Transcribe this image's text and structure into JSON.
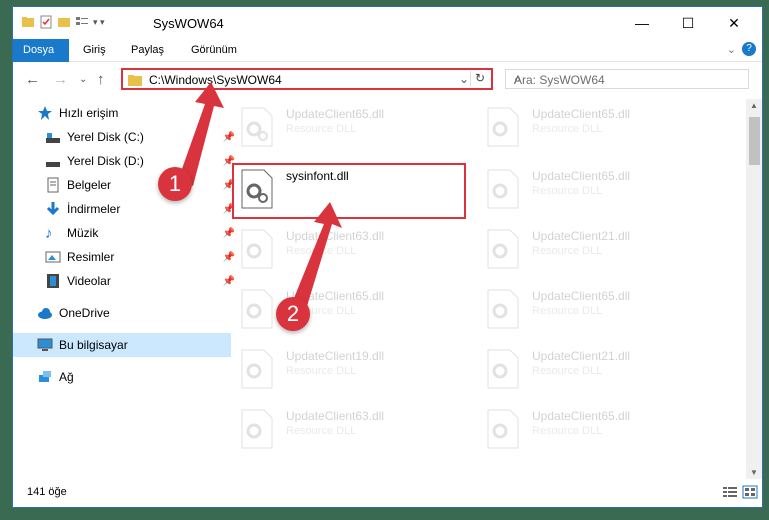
{
  "window": {
    "title": "SysWOW64",
    "controls": {
      "minimize": "—",
      "maximize": "☐",
      "close": "✕"
    }
  },
  "ribbon": {
    "tabs": [
      "Dosya",
      "Giriş",
      "Paylaş",
      "Görünüm"
    ]
  },
  "address": {
    "path": "C:\\Windows\\SysWOW64",
    "search_placeholder": "Ara: SysWOW64"
  },
  "sidebar": {
    "items": [
      {
        "label": "Hızlı erişim",
        "icon": "star-icon",
        "pinned": false
      },
      {
        "label": "Yerel Disk (C:)",
        "icon": "drive-icon",
        "pinned": true
      },
      {
        "label": "Yerel Disk (D:)",
        "icon": "drive-icon",
        "pinned": true
      },
      {
        "label": "Belgeler",
        "icon": "documents-icon",
        "pinned": true
      },
      {
        "label": "İndirmeler",
        "icon": "download-icon",
        "pinned": true
      },
      {
        "label": "Müzik",
        "icon": "music-icon",
        "pinned": true
      },
      {
        "label": "Resimler",
        "icon": "pictures-icon",
        "pinned": true
      },
      {
        "label": "Videolar",
        "icon": "videos-icon",
        "pinned": true
      },
      {
        "label": "OneDrive",
        "icon": "cloud-icon",
        "pinned": false
      },
      {
        "label": "Bu bilgisayar",
        "icon": "computer-icon",
        "pinned": false
      },
      {
        "label": "Ağ",
        "icon": "network-icon",
        "pinned": false
      }
    ]
  },
  "files": {
    "left": [
      {
        "name": "UpdateClient65.dll",
        "type": "Resource DLL"
      },
      {
        "name": "sysinfont.dll",
        "type": ""
      },
      {
        "name": "UpdateClient63.dll",
        "type": "Resource DLL"
      },
      {
        "name": "UpdateClient65.dll",
        "type": "Resource DLL"
      },
      {
        "name": "UpdateClient19.dll",
        "type": "Resource DLL"
      },
      {
        "name": "UpdateClient63.dll",
        "type": "Resource DLL"
      }
    ],
    "right": [
      {
        "name": "UpdateClient65.dll",
        "type": "Resource DLL"
      },
      {
        "name": "UpdateClient65.dll",
        "type": "Resource DLL"
      },
      {
        "name": "UpdateClient21.dll",
        "type": "Resource DLL"
      },
      {
        "name": "UpdateClient65.dll",
        "type": "Resource DLL"
      },
      {
        "name": "UpdateClient21.dll",
        "type": "Resource DLL"
      },
      {
        "name": "UpdateClient65.dll",
        "type": "Resource DLL"
      }
    ]
  },
  "status": {
    "count": "141 öğe"
  },
  "annotations": {
    "step1": "1",
    "step2": "2",
    "color": "#d9343e"
  }
}
